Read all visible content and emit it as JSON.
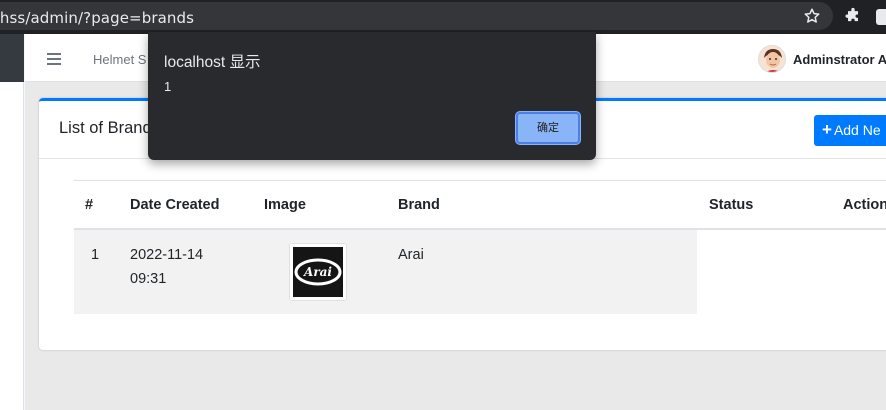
{
  "browser": {
    "url": "/E/hss/admin/?page=brands"
  },
  "navbar": {
    "title": "Helmet S",
    "user_name": "Adminstrator A"
  },
  "card": {
    "title": "List of Brand",
    "add_button_label": "Add Ne"
  },
  "table": {
    "headers": [
      "#",
      "Date Created",
      "Image",
      "Brand",
      "Status",
      "Action"
    ],
    "rows": [
      {
        "num": "1",
        "date": "2022-11-14",
        "time": "09:31",
        "brand": "Arai",
        "logo_text": "Arai"
      }
    ]
  },
  "dialog": {
    "title": "localhost 显示",
    "message": "1",
    "ok_label": "确定"
  },
  "colors": {
    "accent": "#007bff",
    "dialog_bg": "#292a2d",
    "dialog_button": "#8ab4f8"
  },
  "icons": [
    "star-icon",
    "puzzle-extension-icon",
    "hamburger-menu-icon",
    "plus-icon"
  ]
}
